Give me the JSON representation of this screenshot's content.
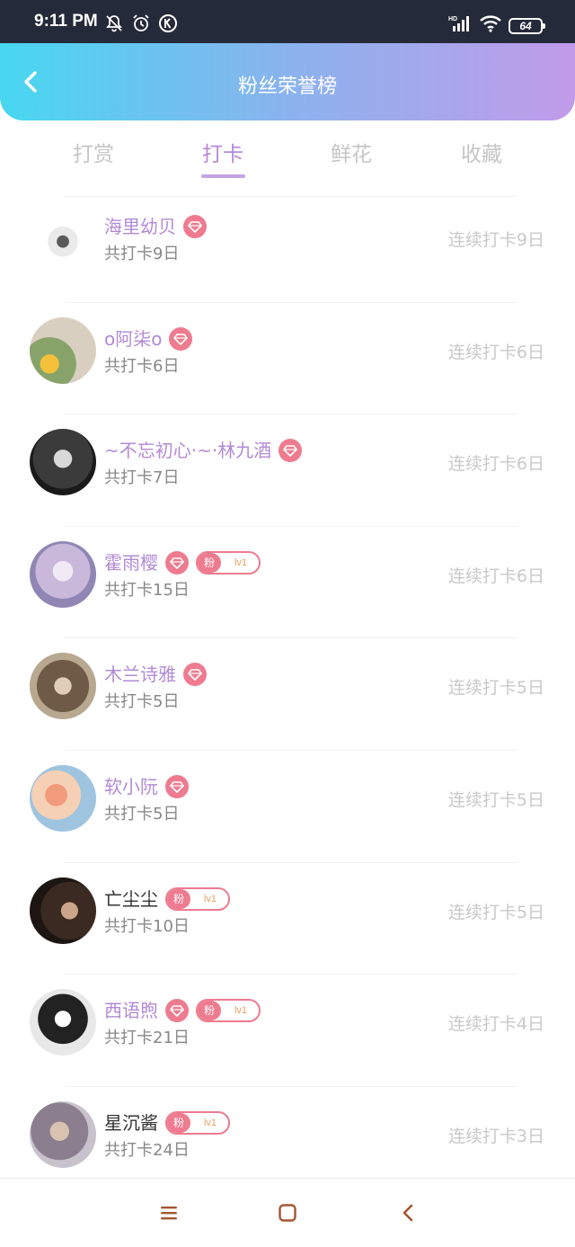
{
  "status_bar": {
    "time": "9:11 PM",
    "battery": "64",
    "icons": [
      "bell-off-icon",
      "alarm-icon",
      "k-app-icon",
      "hd-signal-icon",
      "wifi-icon",
      "battery-icon"
    ]
  },
  "header": {
    "title": "粉丝荣誉榜",
    "back_icon": "chevron-left-icon"
  },
  "tabs": [
    {
      "label": "打赏",
      "active": false
    },
    {
      "label": "打卡",
      "active": true
    },
    {
      "label": "鲜花",
      "active": false
    },
    {
      "label": "收藏",
      "active": false
    }
  ],
  "colors": {
    "accent": "#b48ad8",
    "badge": "#ee7b8f",
    "header_start": "#47d7f0",
    "header_end": "#c19be9"
  },
  "fan_badge": {
    "label": "粉",
    "level": "lv1"
  },
  "rows": [
    {
      "name": "海里幼贝",
      "total": "共打卡9日",
      "streak": "连续打卡9日",
      "diamond": true,
      "fan": false,
      "name_color": "purple"
    },
    {
      "name": "o阿柒o",
      "total": "共打卡6日",
      "streak": "连续打卡6日",
      "diamond": true,
      "fan": false,
      "name_color": "purple"
    },
    {
      "name": "~不忘初心·~·林九酒",
      "total": "共打卡7日",
      "streak": "连续打卡6日",
      "diamond": true,
      "fan": false,
      "name_color": "purple"
    },
    {
      "name": "霍雨樱",
      "total": "共打卡15日",
      "streak": "连续打卡6日",
      "diamond": true,
      "fan": true,
      "name_color": "purple"
    },
    {
      "name": "木兰诗雅",
      "total": "共打卡5日",
      "streak": "连续打卡5日",
      "diamond": true,
      "fan": false,
      "name_color": "purple"
    },
    {
      "name": "软小阮",
      "total": "共打卡5日",
      "streak": "连续打卡5日",
      "diamond": true,
      "fan": false,
      "name_color": "purple"
    },
    {
      "name": "亡尘尘",
      "total": "共打卡10日",
      "streak": "连续打卡5日",
      "diamond": false,
      "fan": true,
      "name_color": "dark"
    },
    {
      "name": "西语煦",
      "total": "共打卡21日",
      "streak": "连续打卡4日",
      "diamond": true,
      "fan": true,
      "name_color": "purple"
    },
    {
      "name": "星沉酱",
      "total": "共打卡24日",
      "streak": "连续打卡3日",
      "diamond": false,
      "fan": true,
      "name_color": "dark"
    }
  ],
  "bottom_nav": [
    "menu-icon",
    "home-square-icon",
    "back-chevron-icon"
  ]
}
